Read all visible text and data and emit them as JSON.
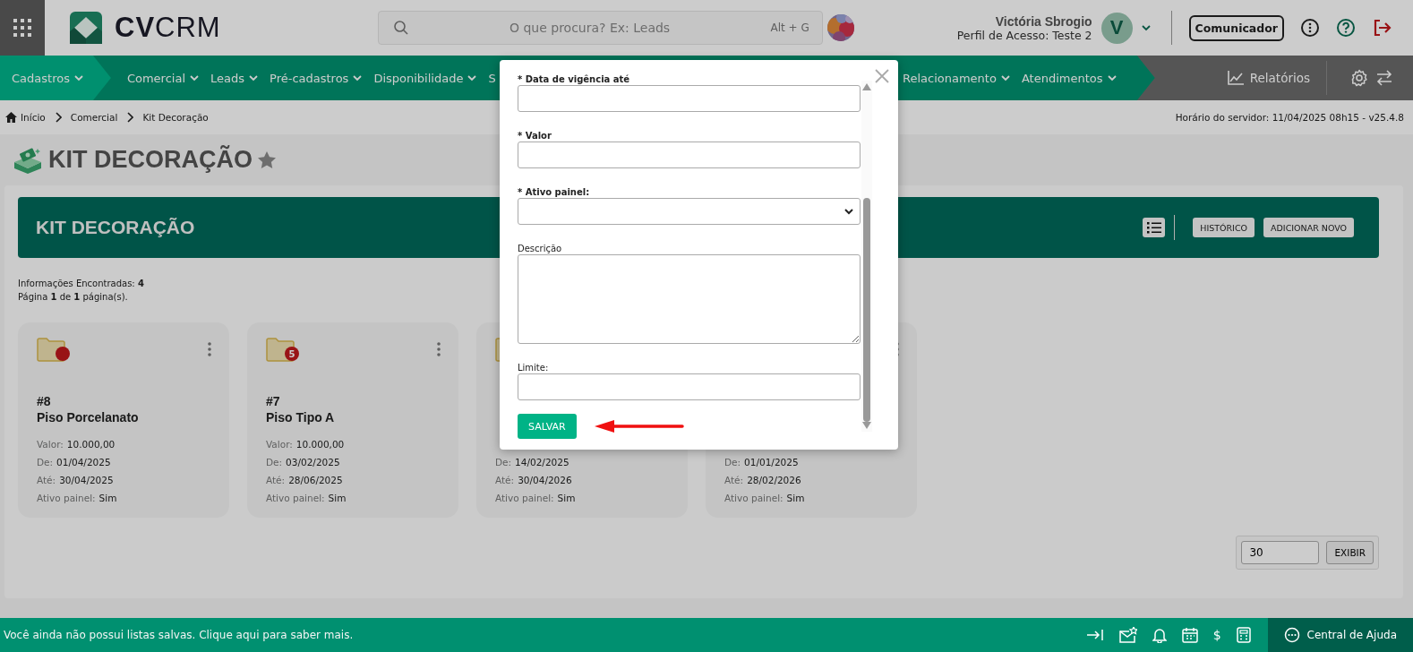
{
  "header": {
    "logo": "**CV**CRM",
    "search": {
      "placeholder": "O que procura? Ex: Leads",
      "shortcut": "Alt + G"
    },
    "user": {
      "name": "Victória Sbrogio",
      "profile": "Perfil de Acesso: Teste 2",
      "initial": "V"
    },
    "communicator": "Comunicador"
  },
  "nav": {
    "menus": [
      {
        "label": "Cadastros",
        "selected": true,
        "caret": true
      },
      {
        "label": "Comercial",
        "selected": false,
        "caret": true
      },
      {
        "label": "Leads",
        "selected": false,
        "caret": true
      },
      {
        "label": "Pré-cadastros",
        "selected": false,
        "caret": true
      },
      {
        "label": "Disponibilidade",
        "selected": false,
        "caret": true
      },
      {
        "label": "S",
        "selected": false,
        "caret": false
      }
    ],
    "menus_right": [
      {
        "label": "Relacionamento",
        "selected": false,
        "caret": true
      },
      {
        "label": "Atendimentos",
        "selected": false,
        "caret": true
      }
    ],
    "reports": "Relatórios"
  },
  "breadcrumb": [
    "Início",
    "Comercial",
    "Kit Decoração"
  ],
  "server_time": "Horário do servidor: 11/04/2025 08h15 - v25.4.8",
  "page_title": "KIT DECORAÇÃO",
  "panel": {
    "title": "KIT DECORAÇÃO",
    "buttons": [
      "HISTÓRICO",
      "ADICIONAR NOVO"
    ],
    "found": "Informações Encontradas: **4**",
    "pages": "Página **1** de **1** página(s).",
    "cards": [
      {
        "folder": true,
        "badge": {
          "kind": "dot"
        },
        "menu": true,
        "id": "#8",
        "name": "Piso Porcelanato",
        "fields": [
          {
            "label": "Valor:",
            "value": "10.000,00"
          },
          {
            "label": "De:",
            "value": "01/04/2025"
          },
          {
            "label": "Até:",
            "value": "30/04/2025"
          },
          {
            "label": "Ativo painel:",
            "value": "Sim"
          }
        ]
      },
      {
        "folder": true,
        "badge": {
          "kind": "count",
          "text": "5"
        },
        "menu": true,
        "id": "#7",
        "name": "Piso Tipo A",
        "fields": [
          {
            "label": "Valor:",
            "value": "10.000,00"
          },
          {
            "label": "De:",
            "value": "03/02/2025"
          },
          {
            "label": "Até:",
            "value": "28/06/2025"
          },
          {
            "label": "Ativo painel:",
            "value": "Sim"
          }
        ]
      },
      {
        "folder": true,
        "menu": false,
        "fields": [
          {
            "label": "De:",
            "value": "14/02/2025"
          },
          {
            "label": "Até:",
            "value": "30/04/2026"
          },
          {
            "label": "Ativo painel:",
            "value": "Sim"
          }
        ]
      },
      {
        "folder": false,
        "menu": true,
        "fields": [
          {
            "label": "De:",
            "value": "01/01/2025"
          },
          {
            "label": "Até:",
            "value": "28/02/2026"
          },
          {
            "label": "Ativo painel:",
            "value": "Sim"
          }
        ]
      }
    ],
    "page_size": "30",
    "show_button": "EXIBIR"
  },
  "footer": {
    "message": "Você ainda não possui listas salvas. Clique aqui para saber mais.",
    "currency": "$",
    "help": "Central de Ajuda"
  },
  "modal": {
    "fields": [
      {
        "kind": "input",
        "label": "* Data de vigência até",
        "required": true
      },
      {
        "kind": "input",
        "label": "* Valor",
        "required": true
      },
      {
        "kind": "select",
        "label": "* Ativo painel:",
        "required": true
      },
      {
        "kind": "textarea",
        "label": "Descrição",
        "required": false
      },
      {
        "kind": "input",
        "label": "Limite:",
        "required": false
      }
    ],
    "save": "SALVAR"
  }
}
